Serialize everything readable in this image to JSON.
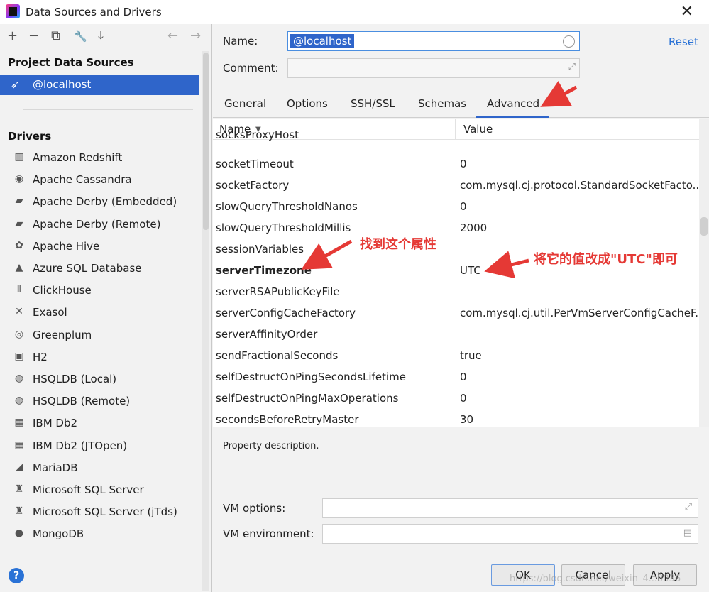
{
  "window": {
    "title": "Data Sources and Drivers",
    "close_glyph": "✕"
  },
  "left": {
    "toolbar": [
      {
        "name": "add-icon",
        "glyph": "+"
      },
      {
        "name": "remove-icon",
        "glyph": "−"
      },
      {
        "name": "copy-icon",
        "glyph": "⧉"
      },
      {
        "name": "wrench-icon",
        "glyph": "🔧"
      },
      {
        "name": "import-icon",
        "glyph": "⤓"
      },
      {
        "name": "back-icon",
        "glyph": "←"
      },
      {
        "name": "forward-icon",
        "glyph": "→"
      }
    ],
    "project_title": "Project Data Sources",
    "selected_source": "@localhost",
    "drivers_title": "Drivers",
    "drivers": [
      {
        "label": "Amazon Redshift",
        "glyph": "▥"
      },
      {
        "label": "Apache Cassandra",
        "glyph": "◉"
      },
      {
        "label": "Apache Derby (Embedded)",
        "glyph": "▰"
      },
      {
        "label": "Apache Derby (Remote)",
        "glyph": "▰"
      },
      {
        "label": "Apache Hive",
        "glyph": "✿"
      },
      {
        "label": "Azure SQL Database",
        "glyph": "▲"
      },
      {
        "label": "ClickHouse",
        "glyph": "⦀"
      },
      {
        "label": "Exasol",
        "glyph": "✕"
      },
      {
        "label": "Greenplum",
        "glyph": "◎"
      },
      {
        "label": "H2",
        "glyph": "▣"
      },
      {
        "label": "HSQLDB (Local)",
        "glyph": "◍"
      },
      {
        "label": "HSQLDB (Remote)",
        "glyph": "◍"
      },
      {
        "label": "IBM Db2",
        "glyph": "▦"
      },
      {
        "label": "IBM Db2 (JTOpen)",
        "glyph": "▦"
      },
      {
        "label": "MariaDB",
        "glyph": "◢"
      },
      {
        "label": "Microsoft SQL Server",
        "glyph": "♜"
      },
      {
        "label": "Microsoft SQL Server (jTds)",
        "glyph": "♜"
      },
      {
        "label": "MongoDB",
        "glyph": "●"
      }
    ],
    "help_glyph": "?"
  },
  "right": {
    "name_label": "Name:",
    "name_value": "@localhost",
    "comment_label": "Comment:",
    "reset_label": "Reset",
    "tabs": [
      "General",
      "Options",
      "SSH/SSL",
      "Schemas",
      "Advanced"
    ],
    "active_tab": "Advanced",
    "table": {
      "col_name": "Name",
      "col_value": "Value",
      "sort_glyph": "▼",
      "rows": [
        {
          "name": "socksProxyHost",
          "value": ""
        },
        {
          "name": "socketTimeout",
          "value": "0"
        },
        {
          "name": "socketFactory",
          "value": "com.mysql.cj.protocol.StandardSocketFacto..."
        },
        {
          "name": "slowQueryThresholdNanos",
          "value": "0"
        },
        {
          "name": "slowQueryThresholdMillis",
          "value": "2000"
        },
        {
          "name": "sessionVariables",
          "value": ""
        },
        {
          "name": "serverTimezone",
          "value": "UTC"
        },
        {
          "name": "serverRSAPublicKeyFile",
          "value": ""
        },
        {
          "name": "serverConfigCacheFactory",
          "value": "com.mysql.cj.util.PerVmServerConfigCacheF..."
        },
        {
          "name": "serverAffinityOrder",
          "value": ""
        },
        {
          "name": "sendFractionalSeconds",
          "value": "true"
        },
        {
          "name": "selfDestructOnPingSecondsLifetime",
          "value": "0"
        },
        {
          "name": "selfDestructOnPingMaxOperations",
          "value": "0"
        },
        {
          "name": "secondsBeforeRetryMaster",
          "value": "30"
        }
      ]
    },
    "property_description": "Property description.",
    "vm_options_label": "VM options:",
    "vm_environment_label": "VM environment:",
    "buttons": {
      "ok": "OK",
      "cancel": "Cancel",
      "apply": "Apply"
    }
  },
  "annotations": {
    "find_property": "找到这个属性",
    "change_value": "将它的值改成\"UTC\"即可",
    "color": "#e53935"
  },
  "watermark": "https://blog.csdn.net/weixin_4...0036"
}
